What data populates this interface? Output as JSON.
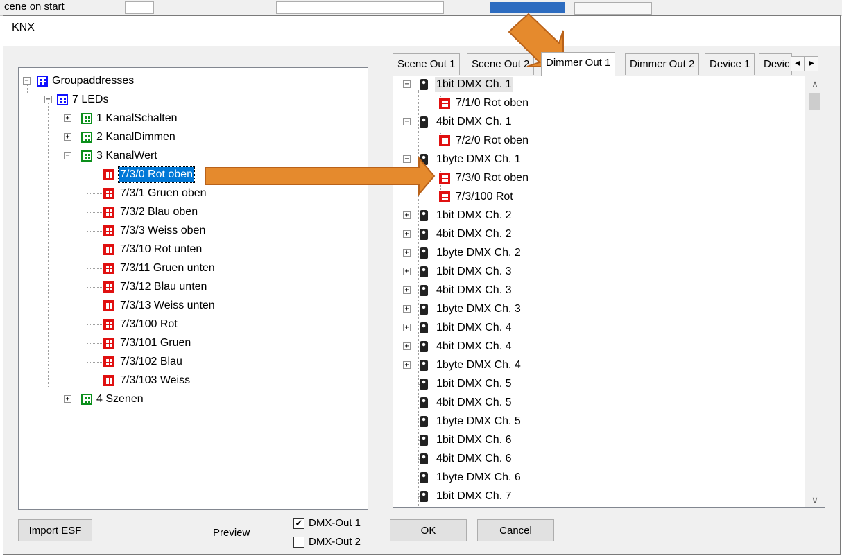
{
  "background": {
    "partial_text": "cene on start"
  },
  "dialog": {
    "title": "KNX"
  },
  "tabs": [
    {
      "label": "Scene Out 1",
      "active": false
    },
    {
      "label": "Scene Out 2",
      "active": false
    },
    {
      "label": "Dimmer Out 1",
      "active": true
    },
    {
      "label": "Dimmer Out 2",
      "active": false
    },
    {
      "label": "Device 1",
      "active": false
    },
    {
      "label": "Devic",
      "active": false
    }
  ],
  "left_tree": {
    "root": "Groupaddresses",
    "group": "7 LEDs",
    "sub1": "1 KanalSchalten",
    "sub2": "2 KanalDimmen",
    "sub3": "3 KanalWert",
    "sub4": "4 Szenen",
    "items": [
      "7/3/0 Rot oben",
      "7/3/1 Gruen oben",
      "7/3/2 Blau oben",
      "7/3/3 Weiss oben",
      "7/3/10 Rot unten",
      "7/3/11 Gruen unten",
      "7/3/12 Blau unten",
      "7/3/13 Weiss unten",
      "7/3/100 Rot",
      "7/3/101 Gruen",
      "7/3/102 Blau",
      "7/3/103 Weiss"
    ]
  },
  "right_tree": {
    "n0": "1bit DMX Ch. 1",
    "n0c0": "7/1/0 Rot oben",
    "n1": "4bit DMX Ch. 1",
    "n1c0": "7/2/0 Rot oben",
    "n2": "1byte DMX Ch. 1",
    "n2c0": "7/3/0 Rot oben",
    "n2c1": "7/3/100 Rot",
    "collapsed": [
      "1bit DMX Ch. 2",
      "4bit DMX Ch. 2",
      "1byte DMX Ch. 2",
      "1bit DMX Ch. 3",
      "4bit DMX Ch. 3",
      "1byte DMX Ch. 3",
      "1bit DMX Ch. 4",
      "4bit DMX Ch. 4",
      "1byte DMX Ch. 4"
    ],
    "leaves": [
      "1bit DMX Ch. 5",
      "4bit DMX Ch. 5",
      "1byte DMX Ch. 5",
      "1bit DMX Ch. 6",
      "4bit DMX Ch. 6",
      "1byte DMX Ch. 6",
      "1bit DMX Ch. 7"
    ]
  },
  "bottom": {
    "import_label": "Import ESF",
    "preview_label": "Preview",
    "dmx_out1": "DMX-Out 1",
    "dmx_out1_checked": true,
    "dmx_out2": "DMX-Out 2",
    "dmx_out2_checked": false,
    "ok_label": "OK",
    "cancel_label": "Cancel"
  },
  "icons": {
    "group_folder": "group-folder-icon",
    "group_address": "group-address-icon",
    "dmx_channel": "dmx-channel-icon"
  },
  "colors": {
    "selection": "#0078d7",
    "annotation_arrow": "#e58a2d",
    "icon_blue": "#1010ff",
    "icon_green": "#0b8f1b",
    "icon_red": "#e01010"
  }
}
